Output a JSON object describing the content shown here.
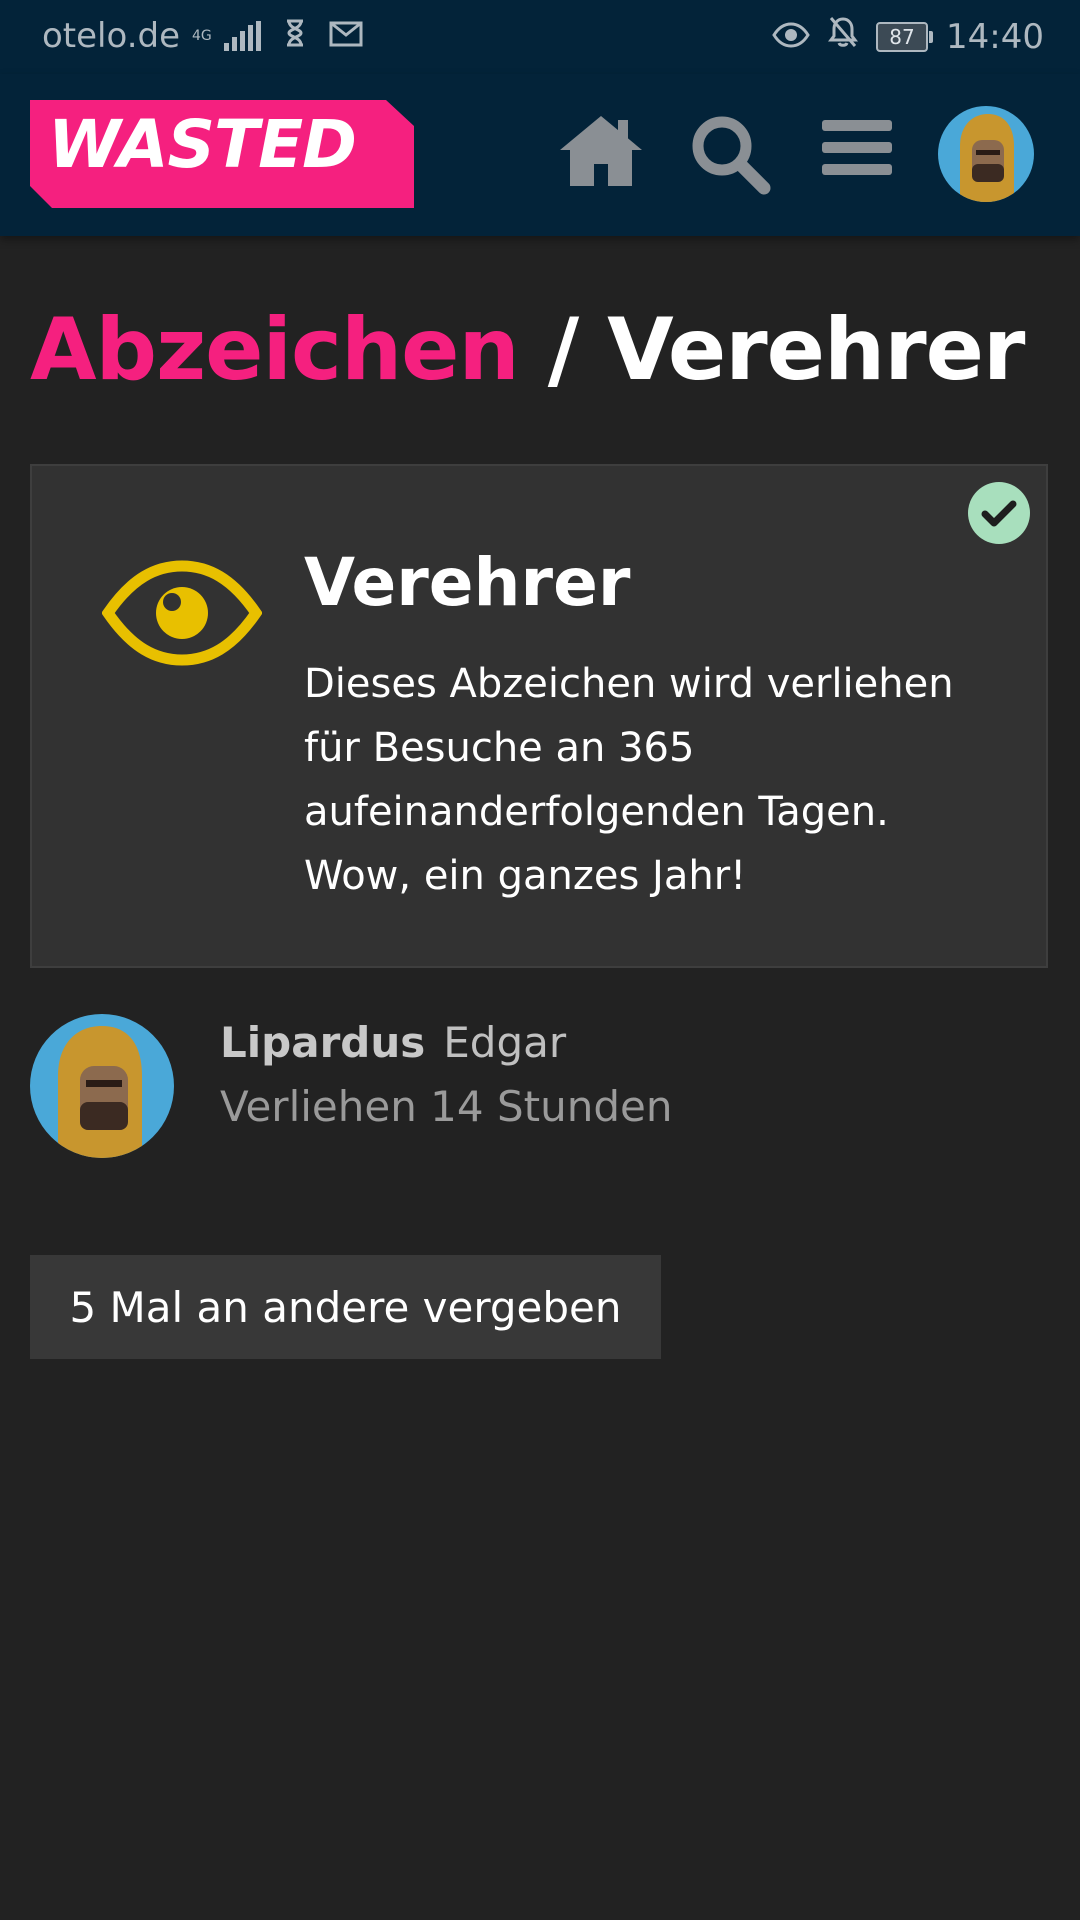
{
  "status_bar": {
    "carrier": "otelo.de",
    "network": "4G",
    "battery": "87",
    "time": "14:40"
  },
  "header": {
    "logo_text": "WASTED",
    "icons": [
      "home-icon",
      "search-icon",
      "menu-icon",
      "avatar"
    ]
  },
  "page": {
    "breadcrumb": "Abzeichen",
    "separator": "/",
    "current": "Verehrer"
  },
  "badge": {
    "name": "Verehrer",
    "description": "Dieses Abzeichen wird verliehen für Besuche an 365 aufeinanderfolgenden Tagen. Wow, ein ganzes Jahr!",
    "icon": "eye-icon",
    "earned_icon": "checkmark-icon"
  },
  "grant": {
    "username": "Lipardus",
    "full_name": "Edgar",
    "granted_text": "Verliehen 14 Stunden"
  },
  "others_button": "5 Mal an andere vergeben",
  "colors": {
    "accent": "#f5207f",
    "header_bg": "#032339",
    "badge_icon": "#e8c000",
    "check_bg": "#a8dfbd"
  }
}
